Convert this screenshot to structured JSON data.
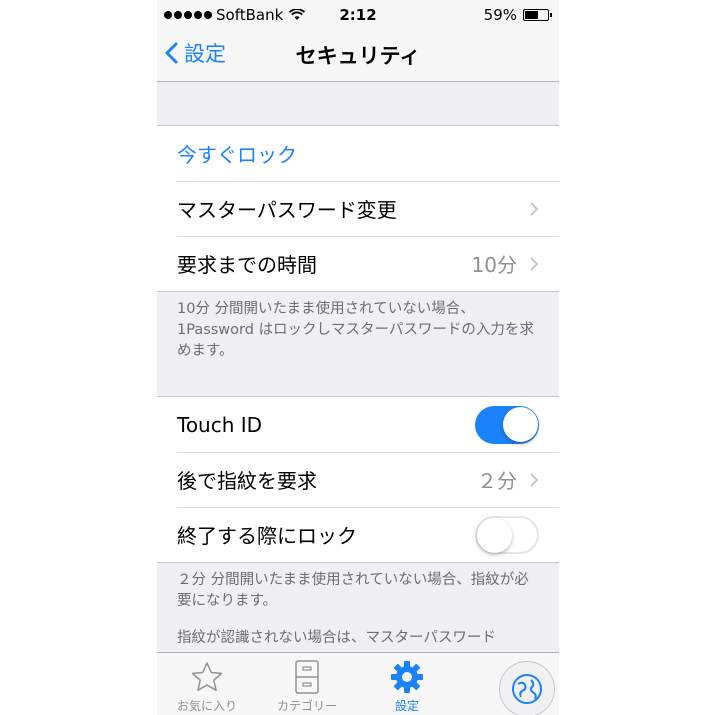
{
  "status_bar": {
    "carrier": "SoftBank",
    "time": "2:12",
    "battery_percent": "59%",
    "battery_level": 0.59
  },
  "nav": {
    "back_label": "設定",
    "title": "セキュリティ"
  },
  "group1": {
    "lock_now": "今すぐロック",
    "change_master_password": "マスターパスワード変更",
    "require_after_label": "要求までの時間",
    "require_after_value": "10分",
    "footer": "10分 分間開いたまま使用されていない場合、1Password はロックしマスターパスワードの入力を求めます。"
  },
  "group2": {
    "touch_id_label": "Touch ID",
    "touch_id_on": true,
    "fingerprint_after_label": "後で指紋を要求",
    "fingerprint_after_value": "２分",
    "lock_on_exit_label": "終了する際にロック",
    "lock_on_exit_on": false,
    "footer_1": "２分 分間開いたまま使用されていない場合、指紋が必要になります。",
    "footer_2": "指紋が認識されない場合は、マスターパスワード"
  },
  "tabbar": {
    "favorites": "お気に入り",
    "categories": "カテゴリー",
    "settings": "設定"
  },
  "colors": {
    "accent": "#1a82fb",
    "background": "#efeff4",
    "secondary_text": "#8e8e93"
  }
}
